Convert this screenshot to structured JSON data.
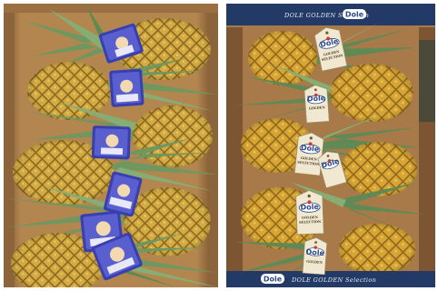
{
  "photos": [
    {
      "caption": ""
    },
    {
      "caption": "",
      "box_banner": {
        "text": "DOLE GOLDEN Selection",
        "brand": "Dole"
      },
      "tags": {
        "brand": "Dole",
        "line1": "GOLDEN",
        "line2": "SELECTION"
      }
    }
  ],
  "colors": {
    "cardboard": "#a87a4a",
    "cardboard_dark": "#6f4f2c",
    "pineapple_skin": "#d2a73e",
    "pineapple_dark": "#9b7a28",
    "pineapple_crown": "#5f8a55",
    "crown_light": "#86ae74",
    "banner_navy": "#233a66",
    "tag_cream": "#f1e8d2",
    "dole_blue": "#2c4a86",
    "dole_red": "#cf3a35",
    "tag_purple": "#3a3fb0"
  }
}
